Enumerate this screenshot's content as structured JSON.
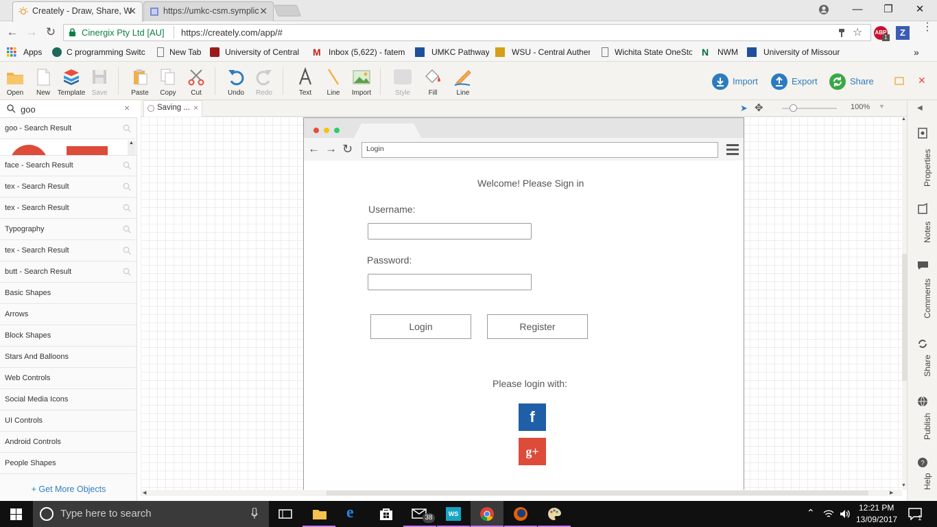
{
  "browser": {
    "tabs": [
      {
        "title": "Creately - Draw, Share, W",
        "active": true
      },
      {
        "title": "https://umkc-csm.symplic",
        "active": false
      }
    ],
    "window_controls": {
      "minimize": "—",
      "restore": "❐",
      "close": "✕"
    },
    "site_identity": "Cinergix Pty Ltd [AU]",
    "url": "https://creately.com/app/#",
    "extensions": [
      "ABP",
      "Z"
    ],
    "extension_badge": "1",
    "bookmarks_apps": "Apps",
    "bookmarks": [
      "C programming Switc",
      "New Tab",
      "University of Central",
      "Inbox (5,622) - fatem",
      "UMKC Pathway",
      "WSU - Central Auther",
      "Wichita State OneSto",
      "NWM",
      "University of Missour"
    ],
    "bookmarks_overflow": "»"
  },
  "toolbar": {
    "tools": [
      {
        "label": "Open",
        "icon": "folder-icon",
        "enabled": true
      },
      {
        "label": "New",
        "icon": "new-document-icon",
        "enabled": true
      },
      {
        "label": "Template",
        "icon": "template-icon",
        "enabled": true
      },
      {
        "label": "Save",
        "icon": "save-icon",
        "enabled": false
      },
      {
        "label": "Paste",
        "icon": "paste-icon",
        "enabled": true
      },
      {
        "label": "Copy",
        "icon": "copy-icon",
        "enabled": true
      },
      {
        "label": "Cut",
        "icon": "scissors-icon",
        "enabled": true
      },
      {
        "label": "Undo",
        "icon": "undo-icon",
        "enabled": true
      },
      {
        "label": "Redo",
        "icon": "redo-icon",
        "enabled": false
      },
      {
        "label": "Text",
        "icon": "text-icon",
        "enabled": true
      },
      {
        "label": "Line",
        "icon": "line-icon",
        "enabled": true
      },
      {
        "label": "Import",
        "icon": "image-icon",
        "enabled": true
      },
      {
        "label": "Style",
        "icon": "style-icon",
        "enabled": false
      },
      {
        "label": "Fill",
        "icon": "fill-bucket-icon",
        "enabled": true
      },
      {
        "label": "Line",
        "icon": "pencil-line-icon",
        "enabled": true
      }
    ],
    "right": {
      "import": "Import",
      "export": "Export",
      "share": "Share"
    }
  },
  "left_panel": {
    "search_value": "goo",
    "clear": "×",
    "items": [
      {
        "label": "goo - Search Result",
        "search": true
      },
      {
        "label": "face - Search Result",
        "search": true
      },
      {
        "label": "tex - Search Result",
        "search": true
      },
      {
        "label": "tex - Search Result",
        "search": true
      },
      {
        "label": "Typography",
        "search": true
      },
      {
        "label": "tex - Search Result",
        "search": true
      },
      {
        "label": "butt - Search Result",
        "search": true
      },
      {
        "label": "Basic Shapes",
        "search": false
      },
      {
        "label": "Arrows",
        "search": false
      },
      {
        "label": "Block Shapes",
        "search": false
      },
      {
        "label": "Stars And Balloons",
        "search": false
      },
      {
        "label": "Web Controls",
        "search": false
      },
      {
        "label": "Social Media Icons",
        "search": false
      },
      {
        "label": "UI Controls",
        "search": false
      },
      {
        "label": "Android Controls",
        "search": false
      },
      {
        "label": "People Shapes",
        "search": false
      }
    ],
    "get_more": "+ Get More Objects"
  },
  "canvas": {
    "doc_tab": "Saving ...",
    "doc_tab_close": "×",
    "zoom": "100%",
    "mockup": {
      "address": "Login",
      "welcome": "Welcome! Please Sign in",
      "username_label": "Username:",
      "password_label": "Password:",
      "login_button": "Login",
      "register_button": "Register",
      "social_prompt": "Please login with:",
      "facebook_glyph": "f",
      "google_glyph": "g+"
    },
    "colors": {
      "facebook": "#1f5fa8",
      "google": "#dd4b39"
    }
  },
  "right_rail": [
    "Properties",
    "Notes",
    "Comments",
    "Share",
    "Publish",
    "Help"
  ],
  "taskbar": {
    "search_placeholder": "Type here to search",
    "mail_badge": "38",
    "time": "12:21 PM",
    "date": "13/09/2017",
    "notification_count": "1"
  }
}
